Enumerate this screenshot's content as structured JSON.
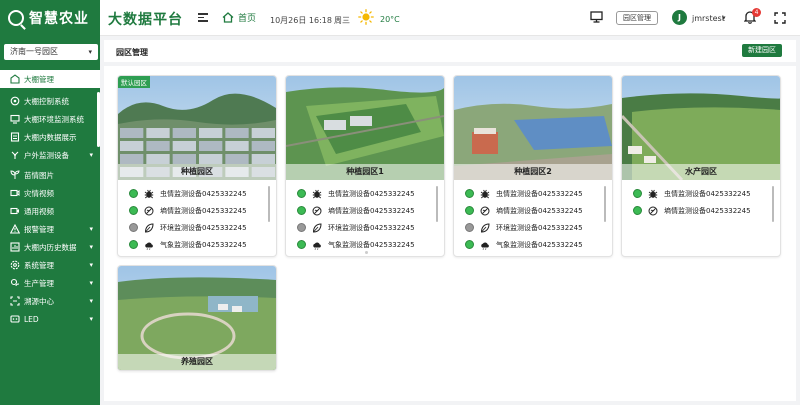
{
  "app": {
    "logo_text": "智慧农业",
    "platform_title": "大数据平台"
  },
  "header": {
    "home_label": "首页",
    "datetime": "10月26日 16:18",
    "weekday": "周三",
    "temperature": "20°C",
    "park_manage_button": "园区管理",
    "user_initial": "J",
    "username": "jmrstest",
    "notification_count": "4"
  },
  "sidebar": {
    "park_selector": "济南一号园区",
    "items": [
      {
        "label": "大棚管理",
        "icon": "greenhouse-icon",
        "active": true
      },
      {
        "label": "大棚控制系统",
        "icon": "control-icon"
      },
      {
        "label": "大棚环境监测系统",
        "icon": "monitor-icon"
      },
      {
        "label": "大棚内数据展示",
        "icon": "data-icon"
      },
      {
        "label": "户外监测设备",
        "icon": "outdoor-icon",
        "expandable": true
      },
      {
        "label": "苗情图片",
        "icon": "sprout-icon"
      },
      {
        "label": "灾情视频",
        "icon": "video-icon"
      },
      {
        "label": "通用视频",
        "icon": "camera-icon"
      },
      {
        "label": "报警管理",
        "icon": "alarm-icon",
        "expandable": true
      },
      {
        "label": "大棚内历史数据",
        "icon": "history-icon",
        "expandable": true
      },
      {
        "label": "系统管理",
        "icon": "settings-icon",
        "expandable": true
      },
      {
        "label": "生产管理",
        "icon": "production-icon",
        "expandable": true
      },
      {
        "label": "溯源中心",
        "icon": "trace-icon",
        "expandable": true
      },
      {
        "label": "LED",
        "icon": "led-icon",
        "expandable": true
      }
    ]
  },
  "page": {
    "title": "园区管理",
    "new_button": "新建园区",
    "default_tag": "默认园区"
  },
  "parks": [
    {
      "name": "种植园区",
      "devices": [
        {
          "name": "虫情监测设备0425332245",
          "status": "on",
          "icon": "bug-icon"
        },
        {
          "name": "墒情监测设备0425332245",
          "status": "on",
          "icon": "soil-icon"
        },
        {
          "name": "环境监测设备0425332245",
          "status": "off",
          "icon": "environment-icon"
        },
        {
          "name": "气象监测设备0425332245",
          "status": "on",
          "icon": "weather-icon"
        }
      ]
    },
    {
      "name": "种植园区1",
      "devices": [
        {
          "name": "虫情监测设备0425332245",
          "status": "on",
          "icon": "bug-icon"
        },
        {
          "name": "墒情监测设备0425332245",
          "status": "on",
          "icon": "soil-icon"
        },
        {
          "name": "环境监测设备0425332245",
          "status": "off",
          "icon": "environment-icon"
        },
        {
          "name": "气象监测设备0425332245",
          "status": "on",
          "icon": "weather-icon"
        }
      ]
    },
    {
      "name": "种植园区2",
      "devices": [
        {
          "name": "虫情监测设备0425332245",
          "status": "on",
          "icon": "bug-icon"
        },
        {
          "name": "墒情监测设备0425332245",
          "status": "on",
          "icon": "soil-icon"
        },
        {
          "name": "环境监测设备0425332245",
          "status": "off",
          "icon": "environment-icon"
        },
        {
          "name": "气象监测设备0425332245",
          "status": "on",
          "icon": "weather-icon"
        }
      ]
    },
    {
      "name": "水产园区",
      "devices": [
        {
          "name": "虫情监测设备0425332245",
          "status": "on",
          "icon": "bug-icon"
        },
        {
          "name": "墒情监测设备0425332245",
          "status": "on",
          "icon": "soil-icon"
        }
      ]
    },
    {
      "name": "养殖园区",
      "devices": []
    }
  ],
  "colors": {
    "brand": "#1f7a3f",
    "online": "#3cba54",
    "offline": "#999999",
    "badge": "#e53935"
  }
}
